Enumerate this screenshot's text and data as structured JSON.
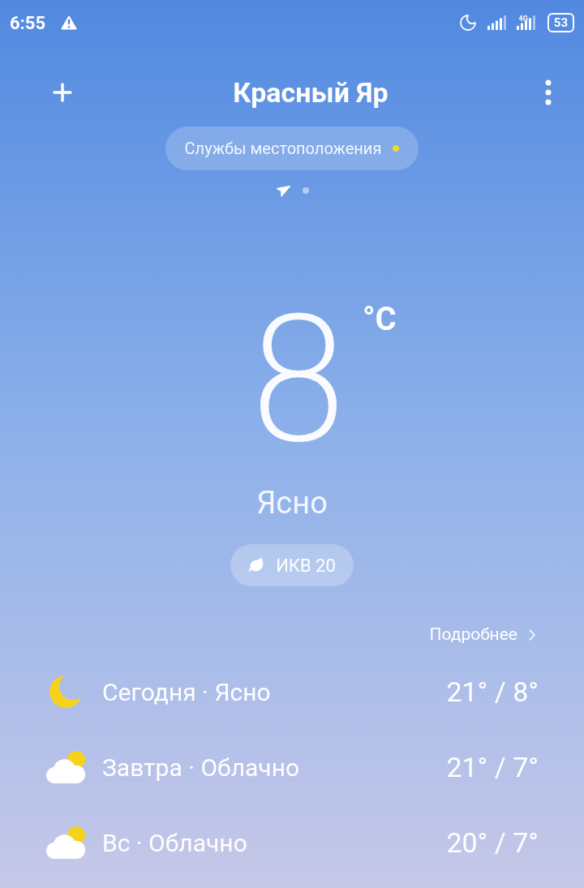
{
  "status_bar": {
    "time": "6:55",
    "network": "4G",
    "battery": "53"
  },
  "header": {
    "city": "Красный Яр",
    "location_chip": {
      "label": "Службы местоположения",
      "color": "#f5d536"
    }
  },
  "pages": [
    {
      "kind": "location",
      "selected": true
    },
    {
      "kind": "dot",
      "selected": false
    }
  ],
  "current": {
    "temperature": "8",
    "unit": "°C",
    "condition": "Ясно",
    "aqi": "ИКВ 20"
  },
  "details_link": "Подробнее",
  "forecast": [
    {
      "kind": "moon",
      "label": "Сегодня · Ясно",
      "temps": "21° / 8°"
    },
    {
      "kind": "cloud-sun",
      "label": "Завтра · Облачно",
      "temps": "21° / 7°"
    },
    {
      "kind": "cloud-sun",
      "label": "Вс · Облачно",
      "temps": "20° / 7°"
    }
  ]
}
